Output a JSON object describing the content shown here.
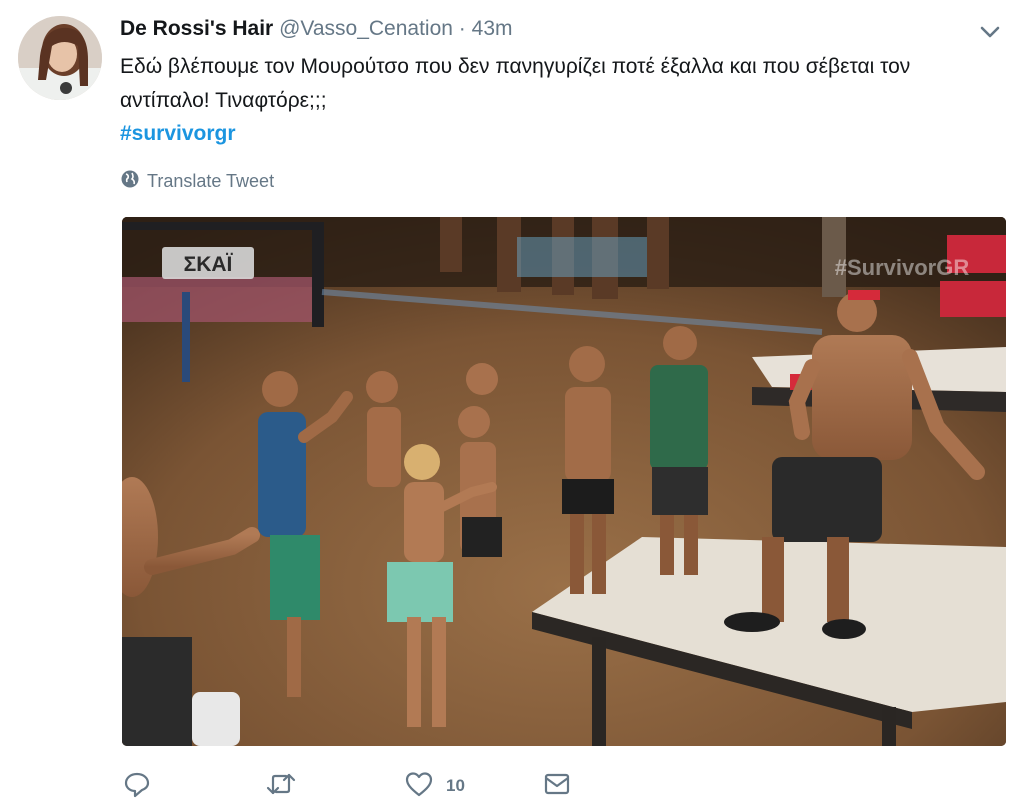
{
  "tweet": {
    "display_name": "De Rossi's Hair",
    "handle": "@Vasso_Cenation",
    "separator": "·",
    "time": "43m",
    "text": "Εδώ βλέπουμε τον Μουρούτσο που δεν πανηγυρίζει ποτέ έξαλλα και που σέβεται τον αντίπαλο! Τιναφτόρε;;;",
    "hashtag": "#survivorgr",
    "translate_label": "Translate Tweet"
  },
  "media": {
    "channel_logo": "ΣΚΑΪ",
    "watermark": "#SurvivorGR"
  },
  "actions": {
    "reply_icon": "reply-icon",
    "retweet_icon": "retweet-icon",
    "like_icon": "heart-icon",
    "like_count": "10",
    "message_icon": "envelope-icon"
  },
  "colors": {
    "link": "#1b95e0",
    "muted": "#657786"
  }
}
